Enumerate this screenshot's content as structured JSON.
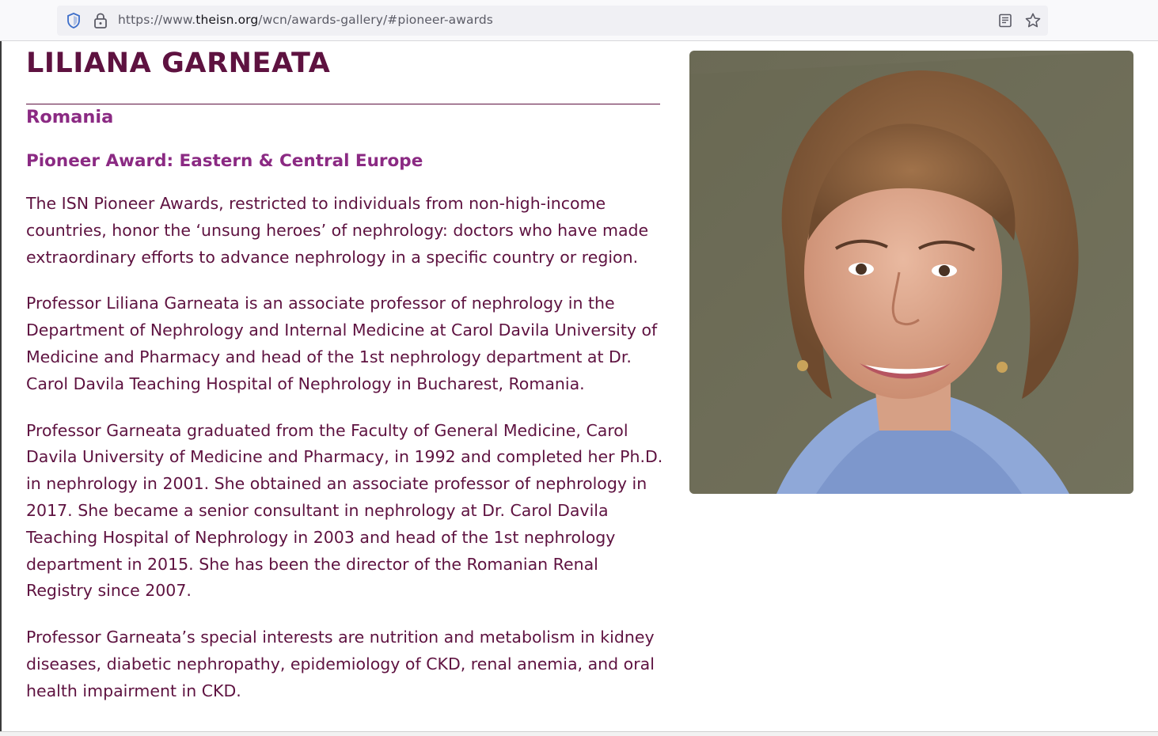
{
  "browser": {
    "url_prefix": "https://www.",
    "url_domain": "theisn.org",
    "url_path": "/wcn/awards-gallery/#pioneer-awards",
    "icons": [
      "shield-icon",
      "lock-icon",
      "reader-mode-icon",
      "bookmark-star-icon"
    ]
  },
  "profile": {
    "name": "LILIANA GARNEATA",
    "country": "Romania",
    "award": "Pioneer Award: Eastern & Central Europe",
    "paragraphs": [
      "The ISN Pioneer Awards, restricted to individuals from non-high-income countries, honor the ‘unsung heroes’ of nephrology: doctors who have made extraordinary efforts to advance nephrology in a specific country or region.",
      "Professor Liliana Garneata is an associate professor of nephrology in the Department of Nephrology and Internal Medicine at Carol Davila University of Medicine and Pharmacy and head of the 1st nephrology department at Dr. Carol Davila Teaching Hospital of Nephrology in Bucharest, Romania.",
      "Professor Garneata graduated from the Faculty of General Medicine, Carol Davila University of Medicine and Pharmacy, in 1992 and completed her Ph.D. in nephrology in 2001. She obtained an associate professor of nephrology in 2017. She became a senior consultant in nephrology at Dr. Carol Davila Teaching Hospital of Nephrology in 2003 and head of the 1st nephrology department in 2015. She has been the director of the Romanian Renal Registry since 2007.",
      "Professor Garneata’s special interests are nutrition and metabolism in kidney diseases, diabetic nephropathy, epidemiology of CKD, renal anemia, and oral health impairment in CKD."
    ]
  },
  "colors": {
    "heading": "#5e1240",
    "subheading": "#8b2a83",
    "body_text": "#5e1240"
  }
}
